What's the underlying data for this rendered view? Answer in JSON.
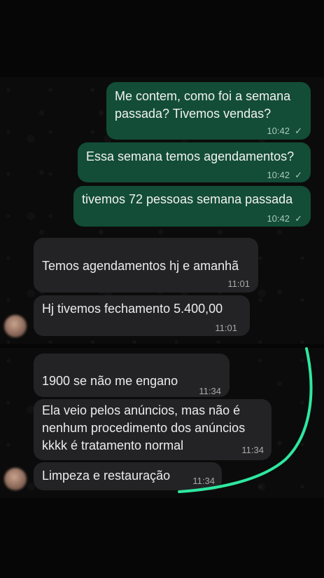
{
  "messages": {
    "m1": {
      "text": "Me contem, como foi a semana\npassada? Tivemos vendas?",
      "time": "10:42"
    },
    "m2": {
      "text": "Essa semana temos agendamentos?",
      "time": "10:42"
    },
    "m3": {
      "text": "tivemos 72 pessoas semana passada",
      "time": "10:42"
    },
    "m4": {
      "text": "Temos agendamentos hj e amanhã",
      "time": "11:01"
    },
    "m5": {
      "text": "Hj tivemos fechamento 5.400,00",
      "time": "11:01"
    },
    "m6": {
      "text": "1900 se não me engano",
      "time": "11:34"
    },
    "m7": {
      "text": "Ela veio pelos anúncios, mas não é\nnenhum procedimento dos anúncios\nkkkk é tratamento normal",
      "time": "11:34"
    },
    "m8": {
      "text": "Limpeza e restauração",
      "time": "11:34"
    }
  },
  "icons": {
    "read_check": "✓"
  },
  "colors": {
    "outgoing_bubble": "#134d37",
    "incoming_bubble": "#232325",
    "annotation_stroke": "#2ee8a0"
  }
}
